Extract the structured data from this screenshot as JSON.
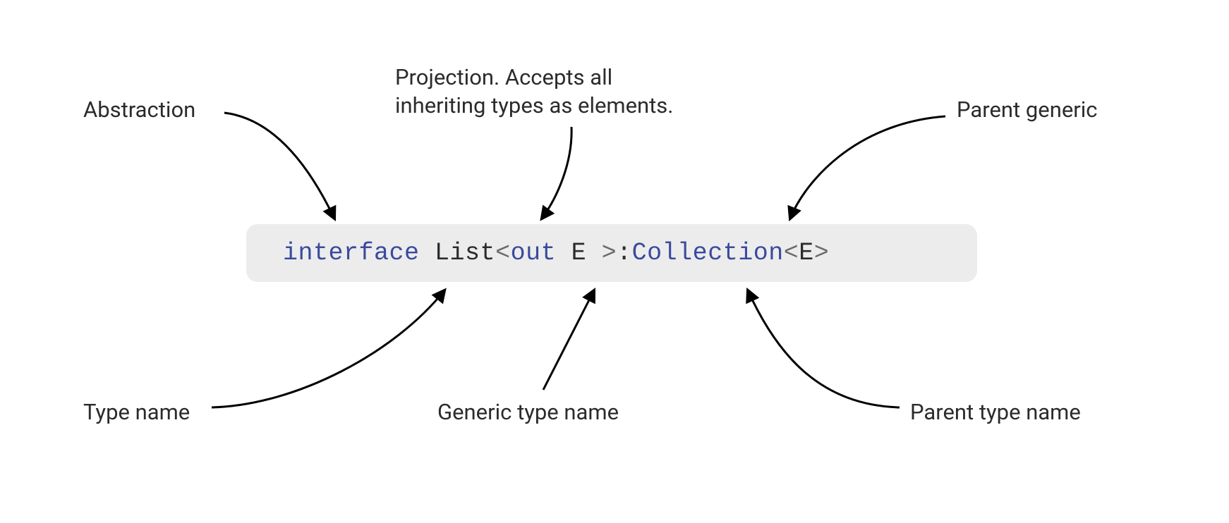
{
  "labels": {
    "abstraction": "Abstraction",
    "projection_line1": "Projection. Accepts all",
    "projection_line2": "inheriting types as elements.",
    "parent_generic": "Parent generic",
    "type_name": "Type name",
    "generic_type_name": "Generic type name",
    "parent_type_name": "Parent type name"
  },
  "code": {
    "keyword": "interface",
    "type_name": "List",
    "lt1": "<",
    "variance": "out",
    "generic_param": "E",
    "gt1": ">",
    "colon": ": ",
    "parent_type": "Collection",
    "lt2": "<",
    "parent_param": "E",
    "gt2": ">"
  },
  "annotations": [
    {
      "id": "abstraction",
      "target": "interface keyword",
      "text": "Abstraction"
    },
    {
      "id": "projection",
      "target": "out keyword",
      "text": "Projection. Accepts all inheriting types as elements."
    },
    {
      "id": "parent-generic",
      "target": "<E> on Collection",
      "text": "Parent generic"
    },
    {
      "id": "type-name",
      "target": "List",
      "text": "Type name"
    },
    {
      "id": "generic-type-name",
      "target": "E",
      "text": "Generic type name"
    },
    {
      "id": "parent-type-name",
      "target": "Collection",
      "text": "Parent type name"
    }
  ],
  "colors": {
    "keyword": "#3a4a9e",
    "text": "#2b2b2b",
    "symbol": "#6b6b6b",
    "code_bg": "#ececec"
  }
}
